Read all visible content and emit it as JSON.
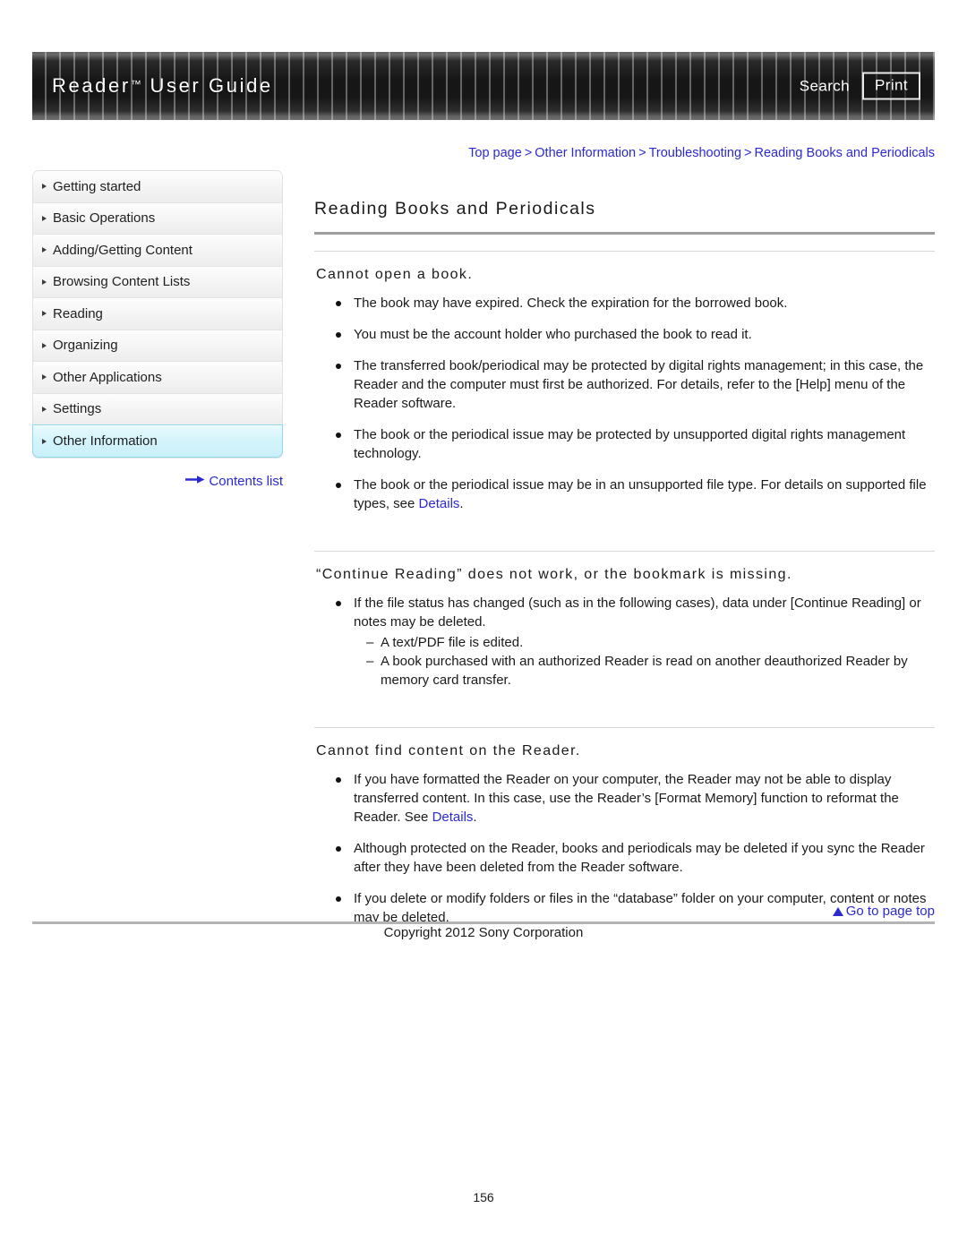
{
  "header": {
    "title_main": "Reader",
    "title_tm": "™",
    "title_rest": " User Guide",
    "search_label": "Search",
    "print_label": "Print"
  },
  "breadcrumb": {
    "items": [
      "Top page",
      "Other Information",
      "Troubleshooting",
      "Reading Books and Periodicals"
    ],
    "separator": ">"
  },
  "sidebar": {
    "items": [
      {
        "label": "Getting started",
        "active": false
      },
      {
        "label": "Basic Operations",
        "active": false
      },
      {
        "label": "Adding/Getting Content",
        "active": false
      },
      {
        "label": "Browsing Content Lists",
        "active": false
      },
      {
        "label": "Reading",
        "active": false
      },
      {
        "label": "Organizing",
        "active": false
      },
      {
        "label": "Other Applications",
        "active": false
      },
      {
        "label": "Settings",
        "active": false
      },
      {
        "label": "Other Information",
        "active": true
      }
    ],
    "contents_list_label": "Contents list",
    "contents_list_arrow": "➡"
  },
  "main": {
    "page_title": "Reading Books and Periodicals",
    "sections": [
      {
        "title": "Cannot open a book.",
        "bullets": [
          {
            "text": "The book may have expired. Check the expiration for the borrowed book."
          },
          {
            "text": "You must be the account holder who purchased the book to read it."
          },
          {
            "text": "The transferred book/periodical may be protected by digital rights management; in this case, the Reader and the computer must first be authorized. For details, refer to the [Help] menu of the Reader software."
          },
          {
            "text": "The book or the periodical issue may be protected by unsupported digital rights management technology."
          },
          {
            "pre": "The book or the periodical issue may be in an unsupported file type. For details on supported file types, see ",
            "link": "Details",
            "post": "."
          }
        ]
      },
      {
        "title": "“Continue Reading” does not work, or the bookmark is missing.",
        "bullets": [
          {
            "text": "If the file status has changed (such as in the following cases), data under [Continue Reading] or notes may be deleted.",
            "sub": [
              "A text/PDF file is edited.",
              "A book purchased with an authorized Reader is read on another deauthorized Reader by memory card transfer."
            ]
          }
        ]
      },
      {
        "title": "Cannot find content on the Reader.",
        "bullets": [
          {
            "pre": "If you have formatted the Reader on your computer, the Reader may not be able to display transferred content. In this case, use the Reader’s [Format Memory] function to reformat the Reader. See ",
            "link": "Details",
            "post": "."
          },
          {
            "text": "Although protected on the Reader, books and periodicals may be deleted if you sync the Reader after they have been deleted from the Reader software."
          },
          {
            "text": "If you delete or modify folders or files in the “database” folder on your computer, content or notes may be deleted."
          }
        ]
      }
    ]
  },
  "footer": {
    "go_to_top_label": "Go to page top",
    "copyright": "Copyright 2012 Sony Corporation",
    "page_number": "156"
  },
  "colors": {
    "link": "#2a2ad0",
    "header_dark": "#161616",
    "active_nav": "#c9f0fa"
  }
}
